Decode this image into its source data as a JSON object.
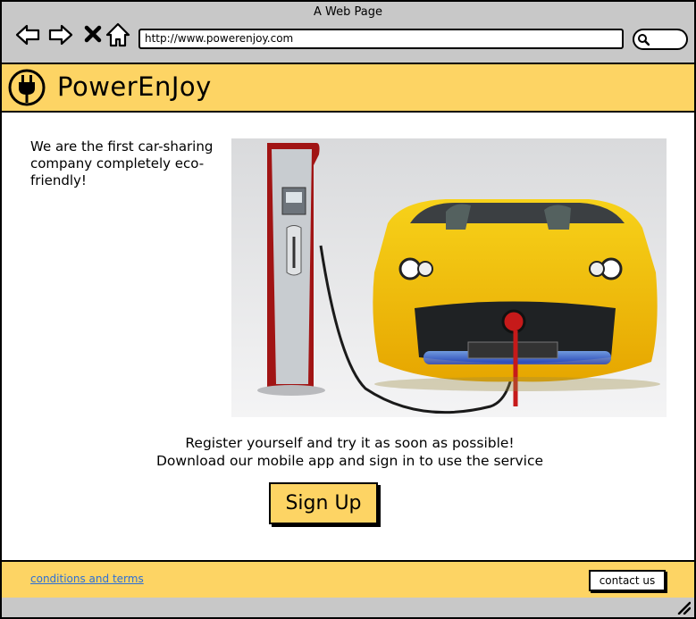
{
  "window": {
    "title": "A Web Page",
    "url": "http://www.powerenjoy.com"
  },
  "nav": {
    "back_icon": "arrow-left-icon",
    "forward_icon": "arrow-right-icon",
    "stop_icon": "close-icon",
    "home_icon": "home-icon",
    "search_icon": "search-icon"
  },
  "header": {
    "brand": "PowerEnJoy",
    "logo_icon": "plug-icon",
    "background": "#fdd464"
  },
  "main": {
    "intro": "We are the first car-sharing company completely eco-friendly!",
    "hero_image": "electric-car-charging-image",
    "cta_line1": "Register yourself and try it as soon as possible!",
    "cta_line2": "Download our mobile app and sign in to use the service",
    "signup_label": "Sign Up"
  },
  "footer": {
    "terms_link": "conditions and terms",
    "contact_label": "contact us",
    "link_color": "#2d6fd6"
  }
}
